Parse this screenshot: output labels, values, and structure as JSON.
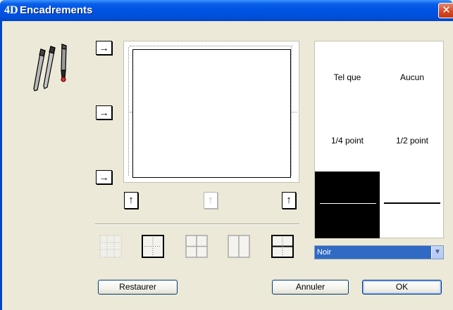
{
  "window": {
    "title": "Encadrements",
    "logo": "4D",
    "close_label": "✕"
  },
  "arrows": {
    "left": [
      "→",
      "→",
      "→"
    ],
    "bottom": [
      "↑",
      "↑",
      "↑"
    ]
  },
  "presets": [
    "grid-dotted-all-icon",
    "frame-outer-icon",
    "grid-all-icon",
    "grid-vertical-icon",
    "grid-horizontal-icon"
  ],
  "line_styles": {
    "cells": [
      "Tel que",
      "Aucun",
      "1/4 point",
      "1/2 point"
    ]
  },
  "color_select": {
    "value": "Noir"
  },
  "buttons": {
    "restore": "Restaurer",
    "cancel": "Annuler",
    "ok": "OK"
  }
}
